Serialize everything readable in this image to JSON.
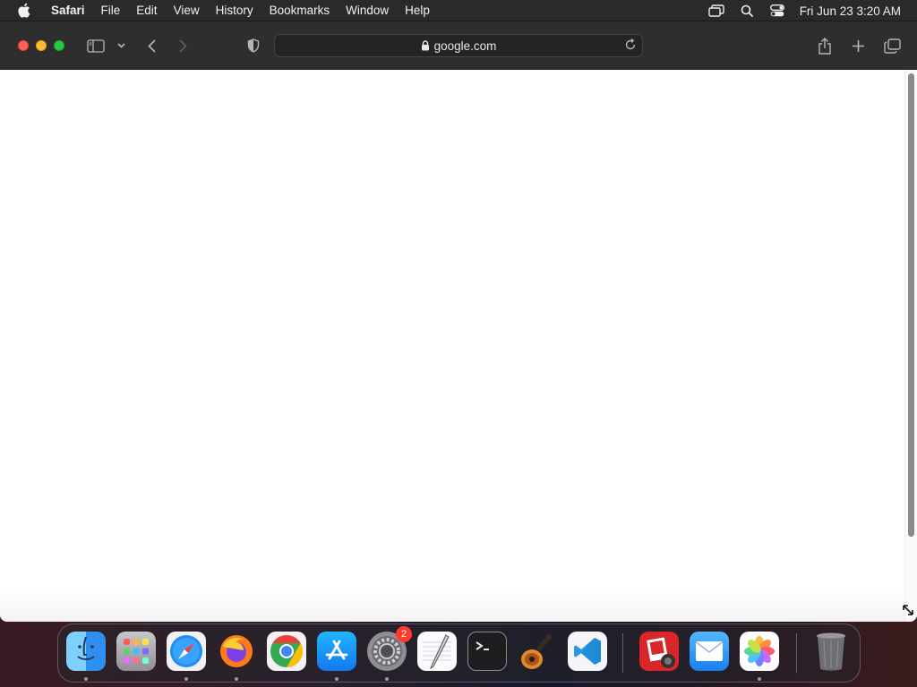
{
  "menubar": {
    "app_name": "Safari",
    "items": [
      "File",
      "Edit",
      "View",
      "History",
      "Bookmarks",
      "Window",
      "Help"
    ],
    "clock": "Fri Jun 23  3:20 AM"
  },
  "browser": {
    "address": "google.com"
  },
  "dock": {
    "apps": [
      {
        "name": "Finder",
        "running": true
      },
      {
        "name": "Launchpad",
        "running": false
      },
      {
        "name": "Safari",
        "running": true
      },
      {
        "name": "Firefox",
        "running": true
      },
      {
        "name": "Chrome",
        "running": false
      },
      {
        "name": "App Store",
        "running": true
      },
      {
        "name": "System Settings",
        "running": true,
        "badge": "2"
      },
      {
        "name": "TextEdit",
        "running": false
      },
      {
        "name": "Terminal",
        "running": false
      },
      {
        "name": "GarageBand",
        "running": false
      },
      {
        "name": "Visual Studio Code",
        "running": false
      },
      {
        "name": "Photo Booth",
        "running": false
      },
      {
        "name": "Mail",
        "running": false
      },
      {
        "name": "Photos",
        "running": true
      },
      {
        "name": "Trash",
        "running": false
      }
    ]
  }
}
